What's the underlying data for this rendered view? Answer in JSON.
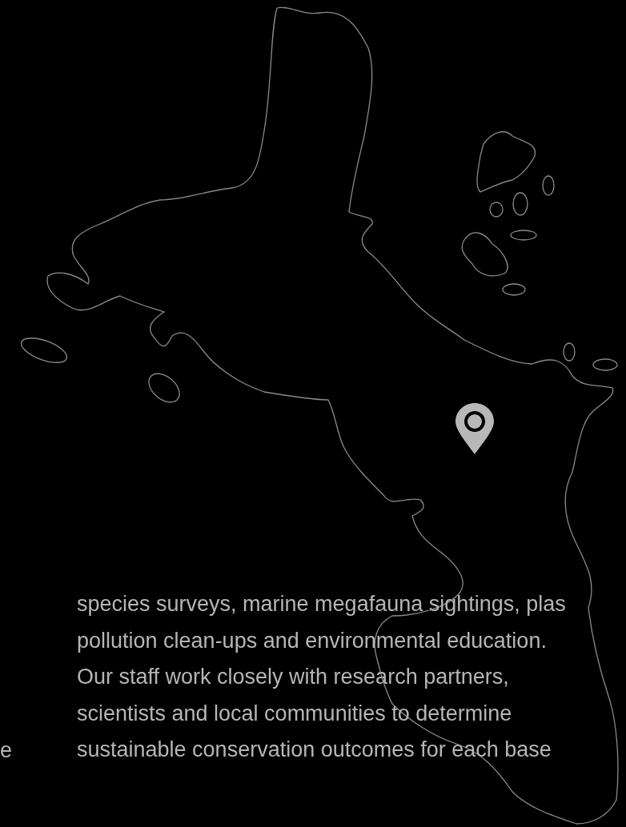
{
  "side_text": "e",
  "paragraph": {
    "lines": [
      "species surveys, marine megafauna sightings, plas",
      "pollution clean-ups and environmental education.",
      "Our staff work closely with research partners,",
      "scientists and local communities to determine",
      "sustainable conservation outcomes for each base"
    ]
  }
}
